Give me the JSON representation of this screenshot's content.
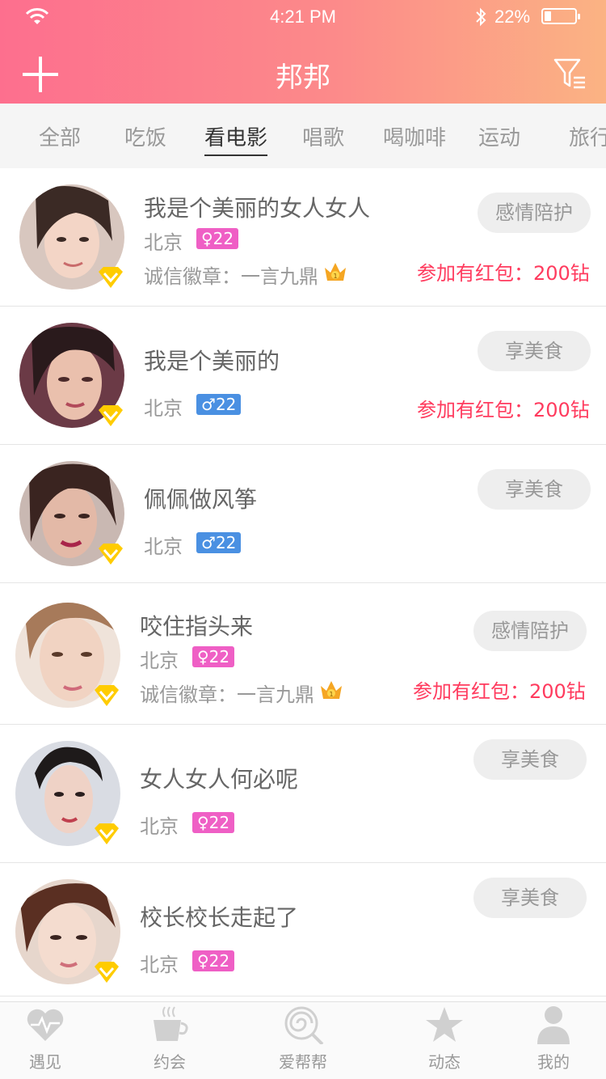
{
  "status_bar": {
    "time": "4:21 PM",
    "battery": "22%",
    "battery_level": 0.22
  },
  "nav": {
    "title": "邦邦",
    "add_icon": "plus-icon",
    "filter_icon": "filter-icon"
  },
  "tabs": [
    {
      "label": "全部",
      "active": false
    },
    {
      "label": "吃饭",
      "active": false
    },
    {
      "label": "看电影",
      "active": true
    },
    {
      "label": "唱歌",
      "active": false
    },
    {
      "label": "喝咖啡",
      "active": false
    },
    {
      "label": "运动",
      "active": false
    },
    {
      "label": "旅行",
      "active": false
    }
  ],
  "users": [
    {
      "name": "我是个美丽的女人女人",
      "city": "北京",
      "gender": "female",
      "age": "22",
      "honor": "诚信徽章：一言九鼎",
      "action": "感情陪护",
      "redpack": "参加有红包：200钻"
    },
    {
      "name": "我是个美丽的",
      "city": "北京",
      "gender": "male",
      "age": "22",
      "action": "享美食",
      "redpack": "参加有红包：200钻"
    },
    {
      "name": "佩佩做风筝",
      "city": "北京",
      "gender": "male",
      "age": "22",
      "action": "享美食"
    },
    {
      "name": "咬住指头来",
      "city": "北京",
      "gender": "female",
      "age": "22",
      "honor": "诚信徽章：一言九鼎",
      "action": "感情陪护",
      "redpack": "参加有红包：200钻"
    },
    {
      "name": "女人女人何必呢",
      "city": "北京",
      "gender": "female",
      "age": "22",
      "action": "享美食"
    },
    {
      "name": "校长校长走起了",
      "city": "北京",
      "gender": "female",
      "age": "22",
      "action": "享美食"
    }
  ],
  "tabbar": [
    {
      "label": "遇见",
      "icon": "heart-pulse-icon"
    },
    {
      "label": "约会",
      "icon": "coffee-cup-icon"
    },
    {
      "label": "爱帮帮",
      "icon": "lollipop-icon"
    },
    {
      "label": "动态",
      "icon": "star-icon"
    },
    {
      "label": "我的",
      "icon": "person-icon"
    }
  ],
  "colors": {
    "header_start": "#fd6f8e",
    "header_end": "#fbb383",
    "redpack": "#ff3b5e",
    "female_badge": "#ef5fc5",
    "male_badge": "#4a90e2",
    "button_bg": "#eeeeee"
  }
}
